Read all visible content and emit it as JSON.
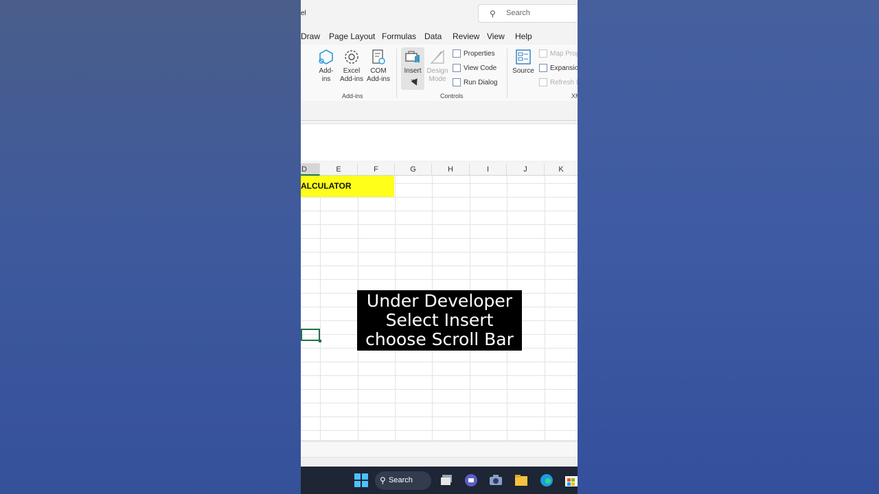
{
  "titlebar": {
    "app_name": "el",
    "search_placeholder": "Search"
  },
  "tabs": [
    "Draw",
    "Page Layout",
    "Formulas",
    "Data",
    "Review",
    "View",
    "Help"
  ],
  "ribbon": {
    "addins": {
      "add_ins": [
        "Add-",
        "ins"
      ],
      "excel_add_ins": [
        "Excel",
        "Add-ins"
      ],
      "com_add_ins": [
        "COM",
        "Add-ins"
      ],
      "group": "Add-ins"
    },
    "controls": {
      "insert": "Insert",
      "design_mode": [
        "Design",
        "Mode"
      ],
      "properties": "Properties",
      "view_code": "View Code",
      "run_dialog": "Run Dialog",
      "group": "Controls"
    },
    "xml": {
      "source": "Source",
      "map_properties": "Map Prop",
      "expansion_packs": "Expansio",
      "refresh_data": "Refresh D",
      "group": "XM"
    }
  },
  "columns": [
    "D",
    "E",
    "F",
    "G",
    "H",
    "I",
    "J",
    "K"
  ],
  "sheet": {
    "title_cell": "ALCULATOR"
  },
  "caption": {
    "lines": [
      "Under Developer",
      "Select Insert",
      "choose Scroll Bar"
    ]
  },
  "taskbar": {
    "search_label": "Search"
  },
  "colors": {
    "excel_green": "#217346",
    "highlight_yellow": "#ffff1a",
    "taskbar": "#1e2535"
  }
}
